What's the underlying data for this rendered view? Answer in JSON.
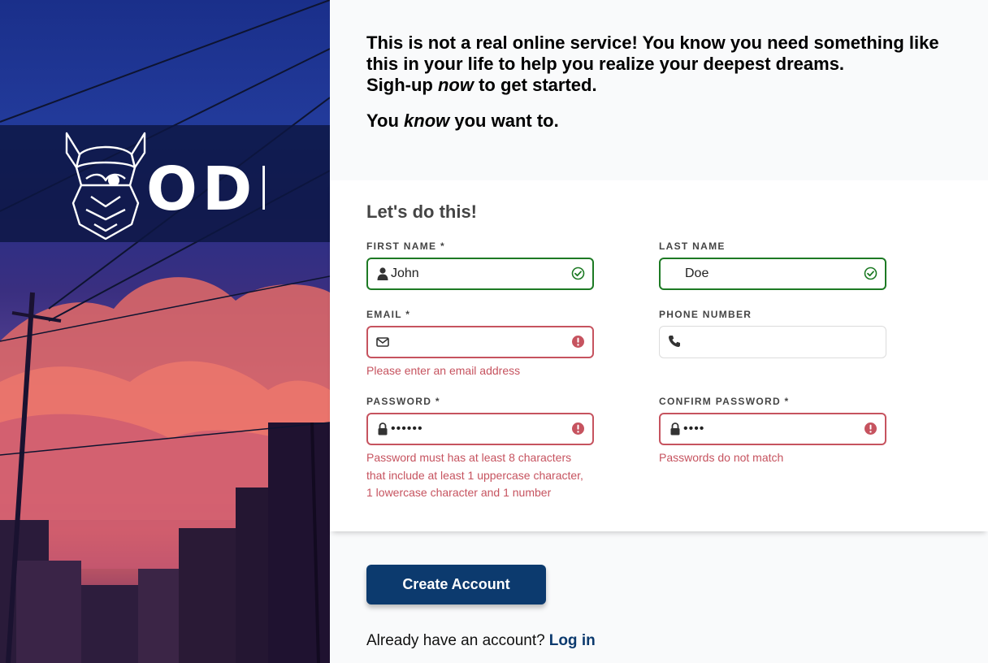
{
  "brand": {
    "name": "ODIN"
  },
  "intro": {
    "line1": "This is not a real online service! You know you need something like this in your life to help you realize your deepest dreams.",
    "line2_pre": "Sigh-up ",
    "line2_em": "now",
    "line2_post": " to get started.",
    "line3_pre": "You ",
    "line3_em": "know",
    "line3_post": " you want to."
  },
  "form": {
    "title": "Let's do this!",
    "fields": {
      "first_name": {
        "label": "FIRST NAME *",
        "value": "John",
        "icon": "user-icon",
        "status": "valid"
      },
      "last_name": {
        "label": "LAST NAME",
        "value": "Doe",
        "status": "valid"
      },
      "email": {
        "label": "EMAIL *",
        "value": "",
        "icon": "envelope-icon",
        "status": "error",
        "error": "Please enter an email address"
      },
      "phone": {
        "label": "PHONE NUMBER",
        "value": "",
        "icon": "phone-icon",
        "status": "neutral"
      },
      "password": {
        "label": "PASSWORD *",
        "value": "••••••",
        "icon": "lock-icon",
        "status": "error",
        "error_lines": [
          "Password must has at least 8 characters",
          "that include at least 1 uppercase character,",
          "1 lowercase character and 1 number"
        ]
      },
      "confirm_password": {
        "label": "CONFIRM PASSWORD *",
        "value": "••••",
        "icon": "lock-icon",
        "status": "error",
        "error": "Passwords do not match"
      }
    }
  },
  "actions": {
    "create_label": "Create Account",
    "login_prompt": "Already have an account?",
    "login_link": "Log in"
  },
  "colors": {
    "primary": "#0c3a6e",
    "valid": "#1d7a24",
    "error": "#c6535f"
  }
}
